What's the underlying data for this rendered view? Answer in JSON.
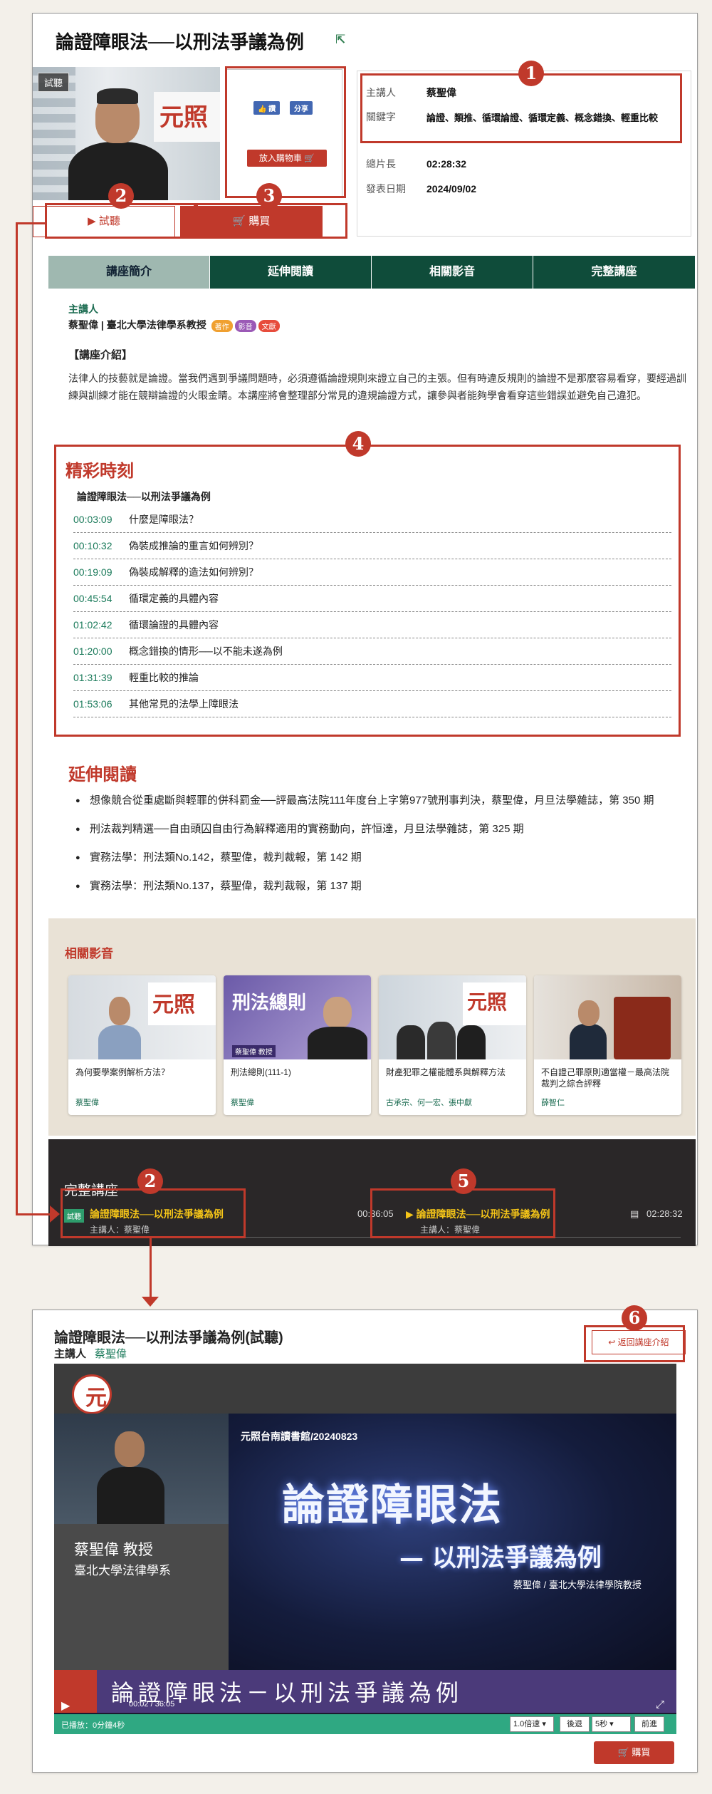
{
  "course": {
    "title": "論證障眼法──以刑法爭議為例",
    "photo_badge": "試聽",
    "fb_like": "👍 讚",
    "fb_share": "分享",
    "cart_small": "放入購物車 🛒",
    "info": [
      {
        "label": "主講人",
        "value": "蔡聖偉"
      },
      {
        "label": "關鍵字",
        "value": "論證、類推、循環論證、循環定義、概念錯換、輕重比較"
      },
      {
        "label": "總片長",
        "value": "02:28:32"
      },
      {
        "label": "發表日期",
        "value": "2024/09/02"
      }
    ],
    "trial_btn": "▶ 試聽",
    "buy_btn": "🛒 購買"
  },
  "tabs": [
    "講座簡介",
    "延伸閱讀",
    "相關影音",
    "完整講座"
  ],
  "intro": {
    "lecturer_label": "主講人",
    "lecturer": "蔡聖偉 | 臺北大學法律學系教授",
    "tags": [
      {
        "text": "著作",
        "color": "#f0a030"
      },
      {
        "text": "影音",
        "color": "#9b59b6"
      },
      {
        "text": "文獻",
        "color": "#e74c3c"
      }
    ],
    "heading": "【講座介紹】",
    "text": "法律人的技藝就是論證。當我們遇到爭議問題時，必須遵循論證規則來證立自己的主張。但有時違反規則的論證不是那麼容易看穿，要經過訓練與訓練才能在競辯論證的火眼金睛。本講座將會整理部分常見的違規論證方式，讓參與者能夠學會看穿這些錯誤並避免自己違犯。"
  },
  "highlights": {
    "title": "精彩時刻",
    "subtitle": "論證障眼法──以刑法爭議為例",
    "chapters": [
      {
        "time": "00:03:09",
        "text": "什麼是障眼法？"
      },
      {
        "time": "00:10:32",
        "text": "偽裝成推論的重言如何辨別？"
      },
      {
        "time": "00:19:09",
        "text": "偽裝成解釋的造法如何辨別？"
      },
      {
        "time": "00:45:54",
        "text": "循環定義的具體內容"
      },
      {
        "time": "01:02:42",
        "text": "循環論證的具體內容"
      },
      {
        "time": "01:20:00",
        "text": "概念錯換的情形──以不能未遂為例"
      },
      {
        "time": "01:31:39",
        "text": "輕重比較的推論"
      },
      {
        "time": "01:53:06",
        "text": "其他常見的法學上障眼法"
      }
    ]
  },
  "extended": {
    "title": "延伸閱讀",
    "items": [
      "想像競合從重處斷與輕罪的併科罰金──評最高法院111年度台上字第977號刑事判決，蔡聖偉，月旦法學雜誌，第 350 期",
      "刑法裁判精選──自由頭囚自由行為解釋適用的實務動向，許恒達，月旦法學雜誌，第 325 期",
      "實務法學：刑法類No.142，蔡聖偉，裁判裁報，第 142 期",
      "實務法學：刑法類No.137，蔡聖偉，裁判裁報，第 137 期"
    ]
  },
  "related": {
    "title": "相關影音",
    "logo_text": "元照",
    "cards": [
      {
        "title": "為何要學案例解析方法？",
        "author": "蔡聖偉"
      },
      {
        "title": "刑法總則(111-1)",
        "author": "蔡聖偉",
        "poster": "刑法總則",
        "poster_name": "蔡聖偉 教授"
      },
      {
        "title": "財產犯罪之權能體系與解釋方法",
        "author": "古承宗、何一宏、張中獻"
      },
      {
        "title": "不自證己罪原則適當權－最高法院裁判之綜合評釋",
        "author": "薛智仁"
      }
    ]
  },
  "full": {
    "title": "完整講座",
    "trial_tag": "試聽",
    "ep1_title": "論證障眼法──以刑法爭議為例",
    "ep1_author": "主講人：蔡聖偉",
    "ep1_time": "00:36:05",
    "ep2_title": "▶ 論證障眼法──以刑法爭議為例",
    "ep2_author": "主講人：蔡聖偉",
    "ep2_time": "02:28:32"
  },
  "annotations": [
    "1",
    "2",
    "3",
    "4",
    "2",
    "5",
    "6"
  ],
  "player": {
    "title": "論證障眼法──以刑法爭議為例(試聽)",
    "lecturer_label": "主講人",
    "lecturer": "蔡聖偉",
    "back": "↩ 返回講座介紹",
    "logo": "元",
    "video_label": "元照台南讀書館/20240823",
    "speaker_name": "蔡聖偉 教授",
    "speaker_title": "臺北大學法律學系",
    "big_title": "論證障眼法",
    "sub_title": "— 以刑法爭議為例",
    "signature": "蔡聖偉 / 臺北大學法律學院教授",
    "band_text": "論證障眼法－以刑法爭議為例",
    "play_icon": "▶",
    "time": "00:02 / 36:05",
    "fullscreen": "⤢",
    "played": "已播放：0分鐘4秒",
    "speed": "1.0倍速 ▾",
    "back_btn": "後退",
    "sec": "5秒 ▾",
    "fwd_btn": "前進",
    "buy": "🛒 購買"
  }
}
